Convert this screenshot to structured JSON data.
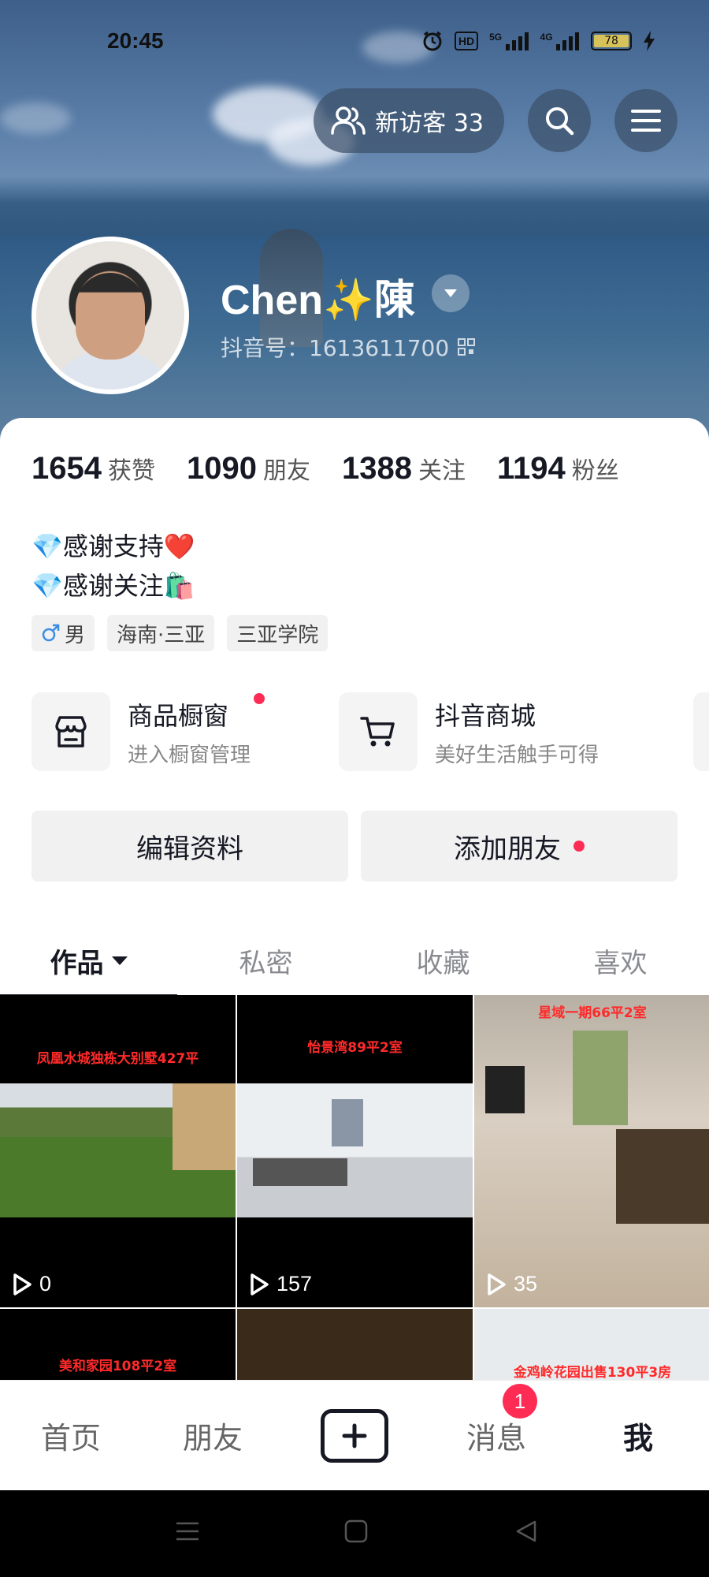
{
  "status_bar": {
    "time": "20:45",
    "hd_label": "HD",
    "signal1_label": "5G",
    "signal2_label": "4G",
    "battery": "78"
  },
  "header": {
    "visitor_label": "新访客 33",
    "user_name": "Chen✨陳",
    "douyin_id": "抖音号：1613611700"
  },
  "stats": [
    {
      "value": "1654",
      "label": "获赞"
    },
    {
      "value": "1090",
      "label": "朋友"
    },
    {
      "value": "1388",
      "label": "关注"
    },
    {
      "value": "1194",
      "label": "粉丝"
    }
  ],
  "bio": {
    "line1": "💎感谢支持❤️",
    "line2": "💎感谢关注🛍️"
  },
  "tags": {
    "gender": "男",
    "location": "海南·三亚",
    "school": "三亚学院"
  },
  "services": [
    {
      "title": "商品橱窗",
      "subtitle": "进入橱窗管理"
    },
    {
      "title": "抖音商城",
      "subtitle": "美好生活触手可得"
    }
  ],
  "actions": {
    "edit_profile": "编辑资料",
    "add_friend": "添加朋友"
  },
  "tabs": [
    "作品",
    "私密",
    "收藏",
    "喜欢"
  ],
  "videos": [
    {
      "title": "凤凰水城独栋大别墅427平",
      "views": "0"
    },
    {
      "title": "怡景湾89平2室",
      "views": "157"
    },
    {
      "title": "星域一期66平2室",
      "views": "35"
    },
    {
      "title": "美和家园108平2室",
      "views": ""
    },
    {
      "title": "",
      "views": ""
    },
    {
      "title": "金鸡岭花园出售130平3房",
      "views": ""
    }
  ],
  "bottom_nav": {
    "home": "首页",
    "friends": "朋友",
    "messages": "消息",
    "messages_badge": "1",
    "me": "我"
  },
  "colors": {
    "accent": "#fe2c55",
    "text_primary": "#161823"
  }
}
